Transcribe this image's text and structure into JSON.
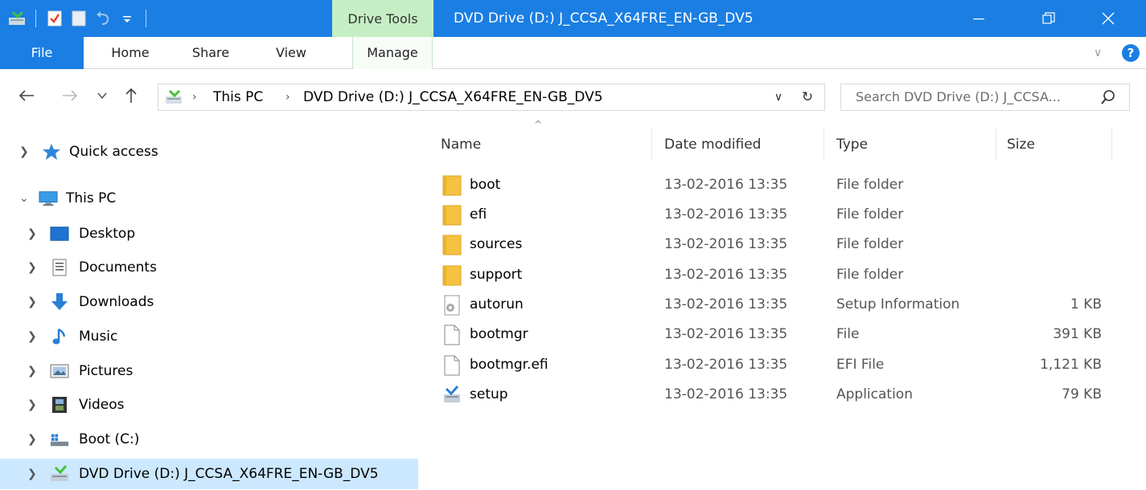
{
  "window": {
    "context_tab": "Drive Tools",
    "title": "DVD Drive (D:) J_CCSA_X64FRE_EN-GB_DV5",
    "controls": {
      "minimize": "—",
      "maximize": "❐",
      "close": "✕"
    }
  },
  "ribbon": {
    "tabs": [
      "File",
      "Home",
      "Share",
      "View",
      "Manage"
    ],
    "expand_glyph": "∨",
    "help_glyph": "?"
  },
  "address": {
    "crumbs": [
      "This PC",
      "DVD Drive (D:) J_CCSA_X64FRE_EN-GB_DV5"
    ],
    "separator": "›",
    "dropdown_glyph": "∨",
    "refresh_glyph": "↻"
  },
  "search": {
    "placeholder": "Search DVD Drive (D:) J_CCSA..."
  },
  "nav_pane": {
    "items": [
      {
        "label": "Quick access",
        "icon": "star-icon",
        "expanded": false
      },
      {
        "label": "This PC",
        "icon": "computer-icon",
        "expanded": true
      },
      {
        "label": "Desktop",
        "icon": "desktop-icon",
        "expanded": false
      },
      {
        "label": "Documents",
        "icon": "documents-icon",
        "expanded": false
      },
      {
        "label": "Downloads",
        "icon": "downloads-icon",
        "expanded": false
      },
      {
        "label": "Music",
        "icon": "music-icon",
        "expanded": false
      },
      {
        "label": "Pictures",
        "icon": "pictures-icon",
        "expanded": false
      },
      {
        "label": "Videos",
        "icon": "videos-icon",
        "expanded": false
      },
      {
        "label": "Boot (C:)",
        "icon": "drive-icon",
        "expanded": false
      },
      {
        "label": "DVD Drive (D:) J_CCSA_X64FRE_EN-GB_DV5",
        "icon": "dvd-drive-icon",
        "expanded": false,
        "selected": true
      }
    ]
  },
  "file_list": {
    "columns": [
      "Name",
      "Date modified",
      "Type",
      "Size"
    ],
    "sort_glyph": "^",
    "rows": [
      {
        "name": "boot",
        "date": "13-02-2016 13:35",
        "type": "File folder",
        "size": "",
        "icon": "folder-icon"
      },
      {
        "name": "efi",
        "date": "13-02-2016 13:35",
        "type": "File folder",
        "size": "",
        "icon": "folder-icon"
      },
      {
        "name": "sources",
        "date": "13-02-2016 13:35",
        "type": "File folder",
        "size": "",
        "icon": "folder-icon"
      },
      {
        "name": "support",
        "date": "13-02-2016 13:35",
        "type": "File folder",
        "size": "",
        "icon": "folder-icon"
      },
      {
        "name": "autorun",
        "date": "13-02-2016 13:35",
        "type": "Setup Information",
        "size": "1 KB",
        "icon": "settings-file-icon"
      },
      {
        "name": "bootmgr",
        "date": "13-02-2016 13:35",
        "type": "File",
        "size": "391 KB",
        "icon": "file-icon"
      },
      {
        "name": "bootmgr.efi",
        "date": "13-02-2016 13:35",
        "type": "EFI File",
        "size": "1,121 KB",
        "icon": "file-icon"
      },
      {
        "name": "setup",
        "date": "13-02-2016 13:35",
        "type": "Application",
        "size": "79 KB",
        "icon": "setup-app-icon"
      }
    ]
  },
  "colors": {
    "accent": "#1a7ee3",
    "context_tab": "#c6eec4",
    "selection": "#cce8ff",
    "folder": "#f5c242"
  }
}
